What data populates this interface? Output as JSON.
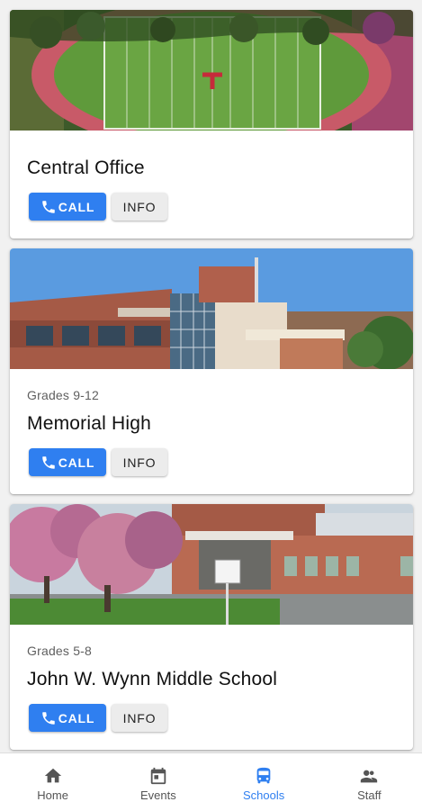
{
  "cards": [
    {
      "grade": "",
      "name": "Central Office",
      "call_label": "CALL",
      "info_label": "INFO",
      "image": "football-field-aerial"
    },
    {
      "grade": "Grades 9-12",
      "name": "Memorial High",
      "call_label": "CALL",
      "info_label": "INFO",
      "image": "brick-school-building"
    },
    {
      "grade": "Grades 5-8",
      "name": "John W. Wynn Middle School",
      "call_label": "CALL",
      "info_label": "INFO",
      "image": "school-with-blossom-trees"
    }
  ],
  "nav": {
    "items": [
      {
        "label": "Home",
        "icon": "home-icon"
      },
      {
        "label": "Events",
        "icon": "calendar-icon"
      },
      {
        "label": "Schools",
        "icon": "bus-icon",
        "active": true
      },
      {
        "label": "Staff",
        "icon": "people-icon"
      }
    ]
  },
  "colors": {
    "accent": "#2f7ff0",
    "background": "#f1f1f1"
  }
}
